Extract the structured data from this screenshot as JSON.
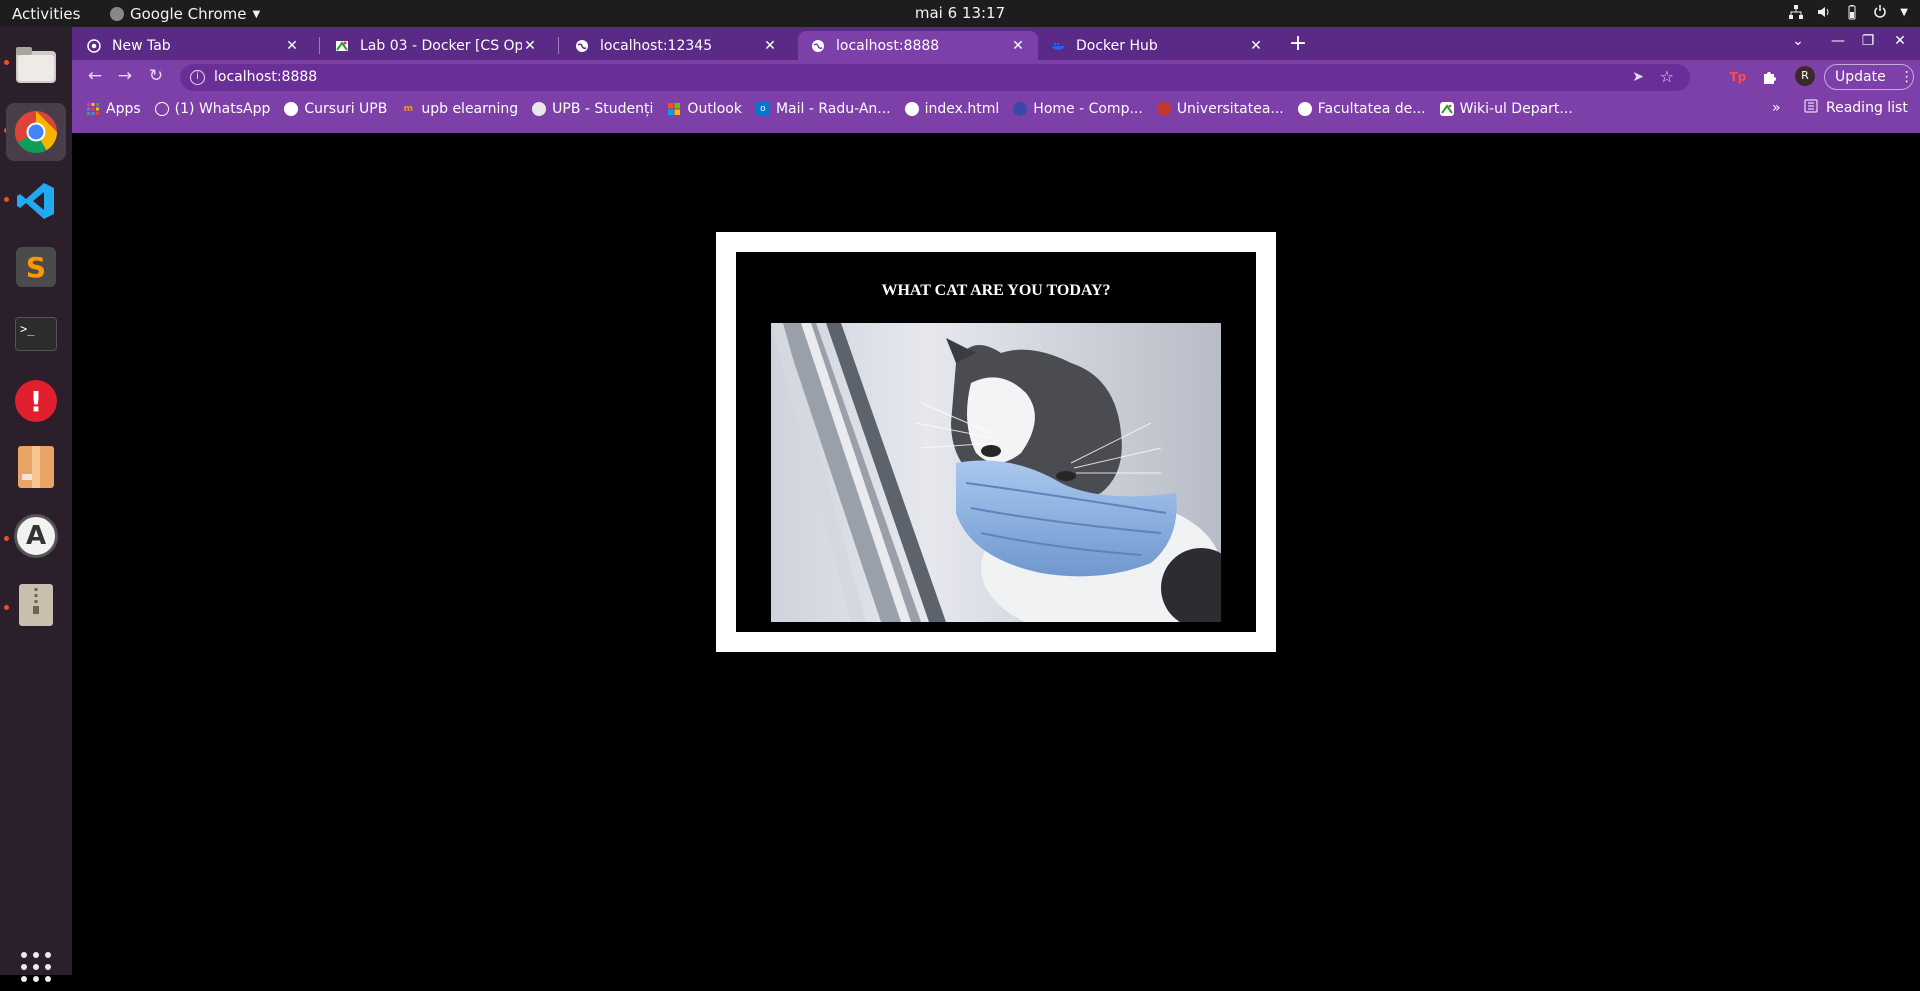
{
  "system": {
    "activities": "Activities",
    "app_name": "Google Chrome",
    "clock": "mai 6  13:17"
  },
  "tabs": [
    {
      "title": "New Tab",
      "active": false
    },
    {
      "title": "Lab 03 - Docker [CS Open C",
      "active": false
    },
    {
      "title": "localhost:12345",
      "active": false
    },
    {
      "title": "localhost:8888",
      "active": true
    },
    {
      "title": "Docker Hub",
      "active": false
    }
  ],
  "toolbar": {
    "url": "localhost:8888",
    "update_label": "Update",
    "profile_initial": "R"
  },
  "bookmarks": [
    {
      "label": "Apps",
      "icon": "apps-grid-icon"
    },
    {
      "label": "(1) WhatsApp",
      "icon": "whatsapp-icon"
    },
    {
      "label": "Cursuri UPB",
      "icon": "globe-icon"
    },
    {
      "label": "upb elearning",
      "icon": "elearning-icon"
    },
    {
      "label": "UPB - Studenți",
      "icon": "upb-icon"
    },
    {
      "label": "Outlook",
      "icon": "microsoft-icon"
    },
    {
      "label": "Mail - Radu-An...",
      "icon": "outlook-icon"
    },
    {
      "label": "index.html",
      "icon": "globe-icon"
    },
    {
      "label": "Home - Comp...",
      "icon": "home-icon"
    },
    {
      "label": "Universitatea...",
      "icon": "university-icon"
    },
    {
      "label": "Facultatea de...",
      "icon": "globe-icon"
    },
    {
      "label": "Wiki-ul Depart...",
      "icon": "wiki-icon"
    }
  ],
  "reading_list": "Reading list",
  "content": {
    "heading": "WHAT CAT ARE YOU TODAY?",
    "image_alt": "cat-wearing-face-mask"
  },
  "colors": {
    "tab_strip": "#5a2a86",
    "toolbar": "#7d3fa8",
    "page_bg": "#000000",
    "frame": "#ffffff"
  }
}
